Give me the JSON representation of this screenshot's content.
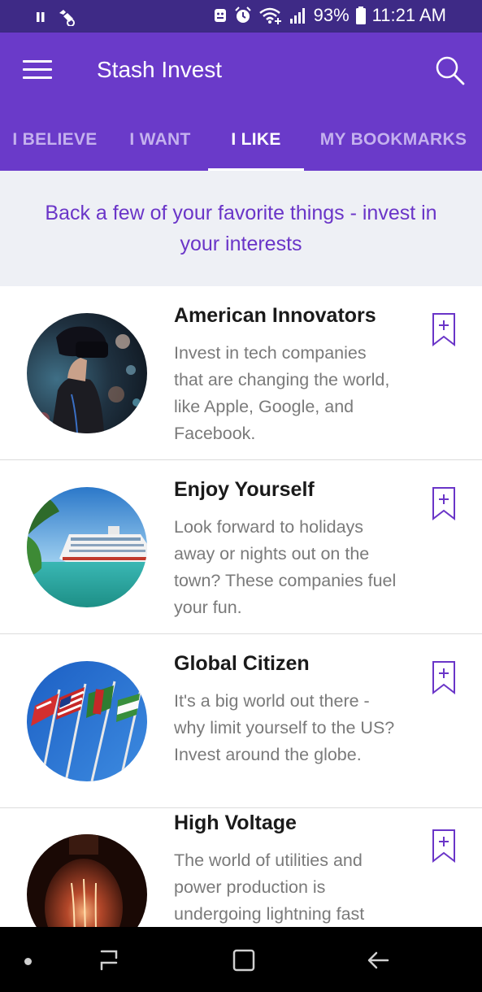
{
  "status_bar": {
    "battery": "93%",
    "time": "11:21 AM"
  },
  "app_bar": {
    "title": "Stash Invest",
    "tabs": [
      {
        "label": "I BELIEVE",
        "active": false
      },
      {
        "label": "I WANT",
        "active": false
      },
      {
        "label": "I LIKE",
        "active": true
      },
      {
        "label": "MY BOOKMARKS",
        "active": false
      }
    ]
  },
  "banner": {
    "text": "Back a few of your favorite things - invest in your interests"
  },
  "list": {
    "items": [
      {
        "title": "American Innovators",
        "desc": "Invest in tech companies that are changing the world,  like Apple, Google, and Facebook.",
        "image": "vr-headset-woman"
      },
      {
        "title": "Enjoy Yourself",
        "desc": "Look forward to holidays away or nights out on the town? These companies fuel your fun.",
        "image": "cruise-ship"
      },
      {
        "title": "Global Citizen",
        "desc": "It's a big world out there - why limit yourself to the US? Invest around the globe.",
        "image": "flags"
      },
      {
        "title": "High Voltage",
        "desc": "The world of utilities and power production is undergoing lightning fast",
        "image": "light-bulb"
      }
    ]
  },
  "colors": {
    "status_bar": "#3e2a86",
    "app_bar": "#6a3ac9",
    "tab_inactive": "#c4b1ee",
    "banner_bg": "#eef0f5",
    "banner_text": "#6a35c8",
    "bookmark": "#6a35c8"
  },
  "icons": {
    "menu": "hamburger-menu-icon",
    "search": "search-icon",
    "bookmark": "bookmark-add-icon",
    "nav_recent": "recent-apps-icon",
    "nav_home": "home-icon",
    "nav_back": "back-icon"
  }
}
